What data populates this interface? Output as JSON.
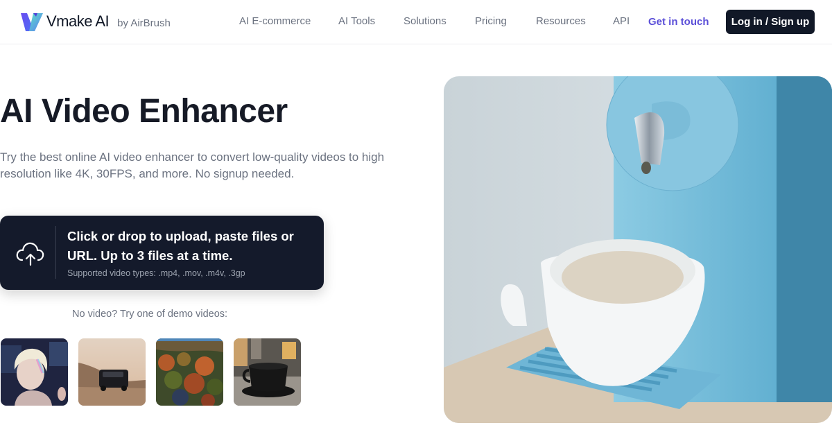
{
  "header": {
    "logo_name": "Vmake AI",
    "logo_by": "by AirBrush",
    "nav": [
      {
        "label": "AI E-commerce"
      },
      {
        "label": "AI Tools"
      },
      {
        "label": "Solutions"
      },
      {
        "label": "Pricing"
      },
      {
        "label": "Resources"
      },
      {
        "label": "API"
      }
    ],
    "contact_label": "Get in touch",
    "login_label": "Log in / Sign up"
  },
  "hero": {
    "title": "AI Video Enhancer",
    "description": "Try the best online AI video enhancer to convert low-quality videos to high resolution like 4K, 30FPS, and more. No signup needed.",
    "image_alt": "Cup of milk coffee under a blue dispenser"
  },
  "upload": {
    "icon": "cloud-upload-icon",
    "main_text": "Click or drop to upload, paste files or URL. Up to 3 files at a time.",
    "supported_text": "Supported video types: .mp4, .mov, .m4v, .3gp"
  },
  "demo": {
    "label": "No video? Try one of demo videos:",
    "videos": [
      {
        "name": "portrait"
      },
      {
        "name": "car-desert"
      },
      {
        "name": "autumn-forest"
      },
      {
        "name": "coffee-cup"
      }
    ]
  },
  "colors": {
    "accent": "#5b4fd8",
    "dark": "#141a2b",
    "text_muted": "#6b7280"
  }
}
